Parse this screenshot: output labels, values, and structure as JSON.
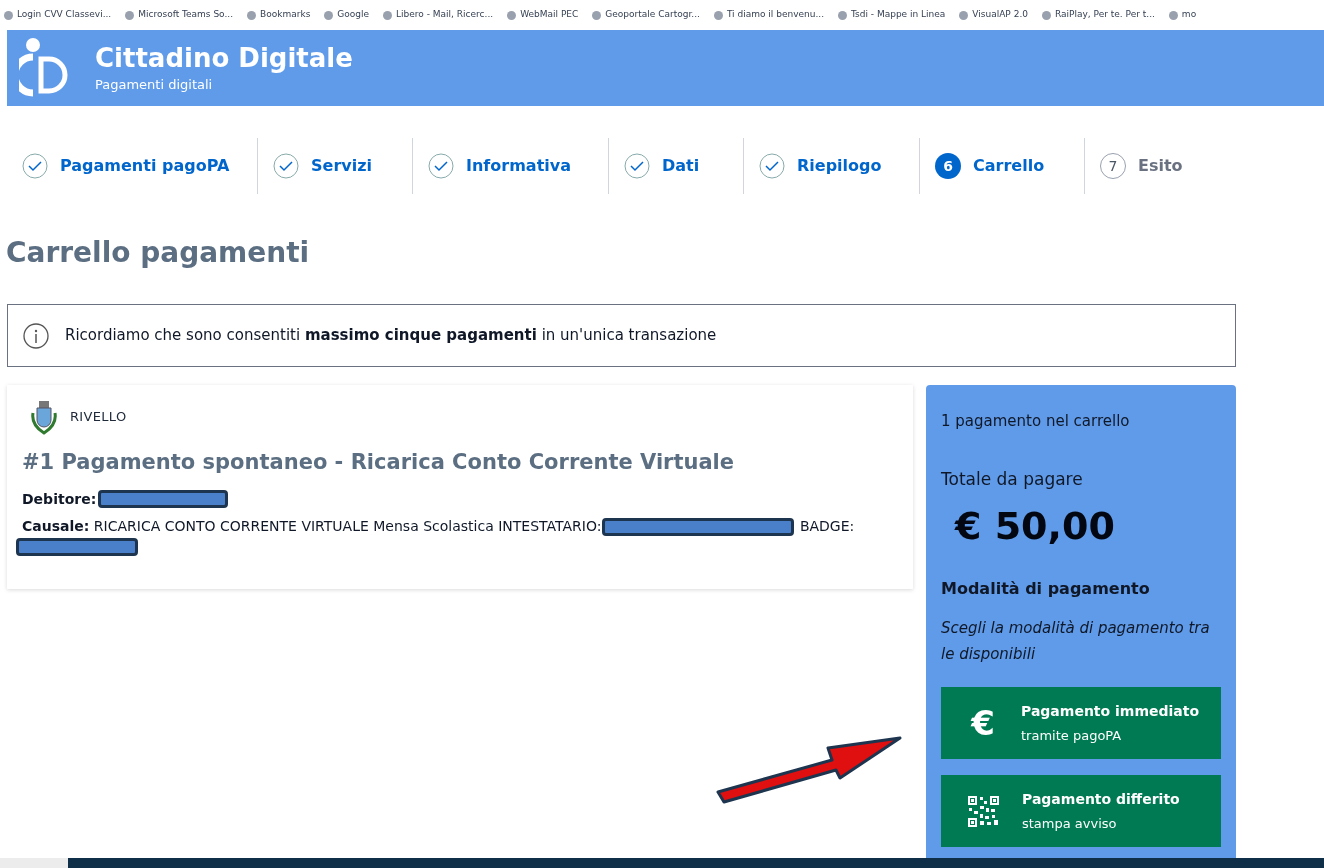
{
  "bookmarks": [
    "Login CVV Classevi...",
    "Microsoft Teams So...",
    "Bookmarks",
    "Google",
    "Libero - Mail, Ricerc...",
    "WebMail PEC",
    "Geoportale Cartogr...",
    "Ti diamo il benvenu...",
    "Tsdi - Mappe in Linea",
    "VisualAP 2.0",
    "RaiPlay, Per te. Per t...",
    "mo"
  ],
  "header": {
    "title": "Cittadino Digitale",
    "subtitle": "Pagamenti digitali"
  },
  "steps": [
    {
      "label": "Pagamenti pagoPA",
      "completed": true,
      "selected": false
    },
    {
      "label": "Servizi",
      "completed": true,
      "selected": false
    },
    {
      "label": "Informativa",
      "completed": true,
      "selected": false
    },
    {
      "label": "Dati",
      "completed": true,
      "selected": false
    },
    {
      "label": "Riepilogo",
      "completed": true,
      "selected": false
    },
    {
      "label": "Carrello",
      "completed": false,
      "selected": true,
      "number": "6"
    },
    {
      "label": "Esito",
      "completed": false,
      "selected": false,
      "number": "7"
    }
  ],
  "page_title": "Carrello pagamenti",
  "notice": "Ricordiamo che sono consentiti **massimo cinque pagamenti** in un'unica transazione",
  "payment": {
    "entity": "RIVELLO",
    "title": "#1 Pagamento spontaneo - Ricarica Conto Corrente Virtuale",
    "debtor_label": "Debitore:",
    "reason_label": "Causale:",
    "reason_parts": [
      "RICARICA CONTO CORRENTE VIRTUALE Mensa Scolastica INTESTATARIO:",
      "BADGE:"
    ]
  },
  "cart": {
    "count": "1 pagamento nel carrello",
    "total_label": "Totale da pagare",
    "total": "€ 50,00",
    "methods_title": "Modalità di pagamento",
    "methods_hint": "Scegli la modalità di pagamento tra le disponibili",
    "methods": [
      {
        "kind": "euro",
        "glyph": "€",
        "title": "Pagamento immediato",
        "subtitle": "tramite pagoPA"
      },
      {
        "kind": "qr",
        "title": "Pagamento differito",
        "subtitle": "stampa avviso"
      }
    ]
  }
}
